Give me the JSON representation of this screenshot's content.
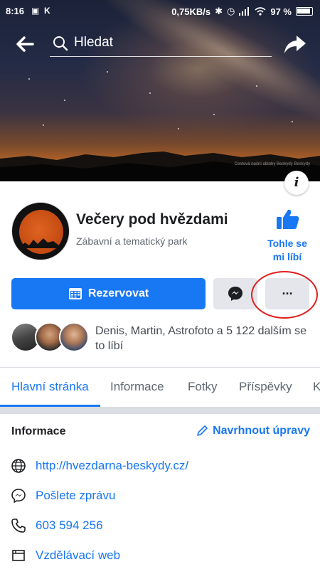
{
  "status_bar": {
    "time": "8:16",
    "network_speed": "0,75KB/s",
    "battery": "97 %"
  },
  "search": {
    "placeholder": "Hledat"
  },
  "cover": {
    "watermark": "Cestová noční oblohy Beskydy Beskydy"
  },
  "page": {
    "name": "Večery pod hvězdami",
    "category": "Zábavní a tematický park",
    "like_label": "Tohle se mi líbí"
  },
  "actions": {
    "reserve_label": "Rezervovat",
    "more_label": "···"
  },
  "friends": {
    "text": "Denis, Martin, Astrofoto a 5 122 dalším se to líbí"
  },
  "tabs": [
    {
      "label": "Hlavní stránka",
      "active": true
    },
    {
      "label": "Informace"
    },
    {
      "label": "Fotky"
    },
    {
      "label": "Příspěvky"
    },
    {
      "label": "K"
    }
  ],
  "info": {
    "title": "Informace",
    "suggest_label": "Navrhnout úpravy",
    "rows": [
      {
        "icon": "globe-icon",
        "text": "http://hvezdarna-beskydy.cz/"
      },
      {
        "icon": "messenger-icon",
        "text": "Pošlete zprávu"
      },
      {
        "icon": "phone-icon",
        "text": "603 594 256"
      },
      {
        "icon": "category-icon",
        "text": "Vzdělávací web"
      }
    ]
  },
  "colors": {
    "accent": "#1877f2",
    "highlight": "#e02020"
  }
}
